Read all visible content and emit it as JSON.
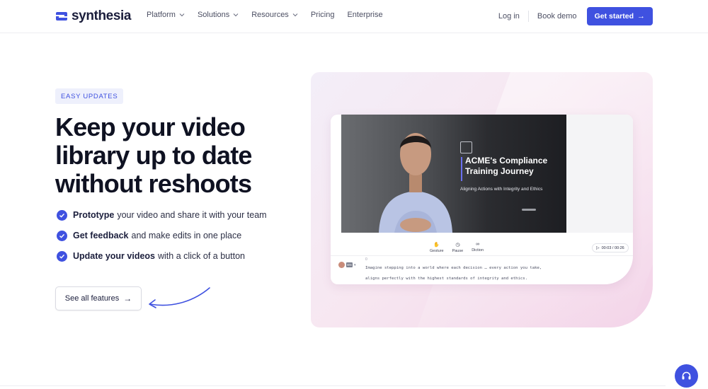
{
  "header": {
    "logo_text": "synthesia",
    "nav": [
      {
        "label": "Platform",
        "has_dropdown": true
      },
      {
        "label": "Solutions",
        "has_dropdown": true
      },
      {
        "label": "Resources",
        "has_dropdown": true
      },
      {
        "label": "Pricing",
        "has_dropdown": false
      },
      {
        "label": "Enterprise",
        "has_dropdown": false
      }
    ],
    "login_label": "Log in",
    "demo_label": "Book demo",
    "cta_label": "Get started",
    "cta_icon": "arrow-right-icon"
  },
  "hero": {
    "badge": "EASY UPDATES",
    "headline": "Keep your video library up to date without reshoots",
    "features": [
      {
        "bold": "Prototype",
        "rest": "your video and share it with your team"
      },
      {
        "bold": "Get feedback",
        "rest": "and make edits in one place"
      },
      {
        "bold": "Update your videos",
        "rest": "with a click of a button"
      }
    ],
    "button_label": "See all features"
  },
  "editor": {
    "video_title": "ACME's Compliance Training Journey",
    "video_subtitle": "Aligning Actions with Integrity and Ethics",
    "tools": [
      {
        "label": "Gesture",
        "icon": "hand-icon"
      },
      {
        "label": "Pause",
        "icon": "clock-icon"
      },
      {
        "label": "Diction",
        "icon": "mask-icon"
      }
    ],
    "time": "00:03 / 00:26",
    "script_index": "0",
    "lang_badge": "EN",
    "script_lines": [
      "Imagine stepping into a world where each decision … every action you take,",
      "aligns perfectly with the highest standards of integrity and ethics."
    ]
  },
  "colors": {
    "accent": "#3f51e0",
    "text": "#0f1222",
    "panel_gradient_end": "#f3d3e8"
  }
}
